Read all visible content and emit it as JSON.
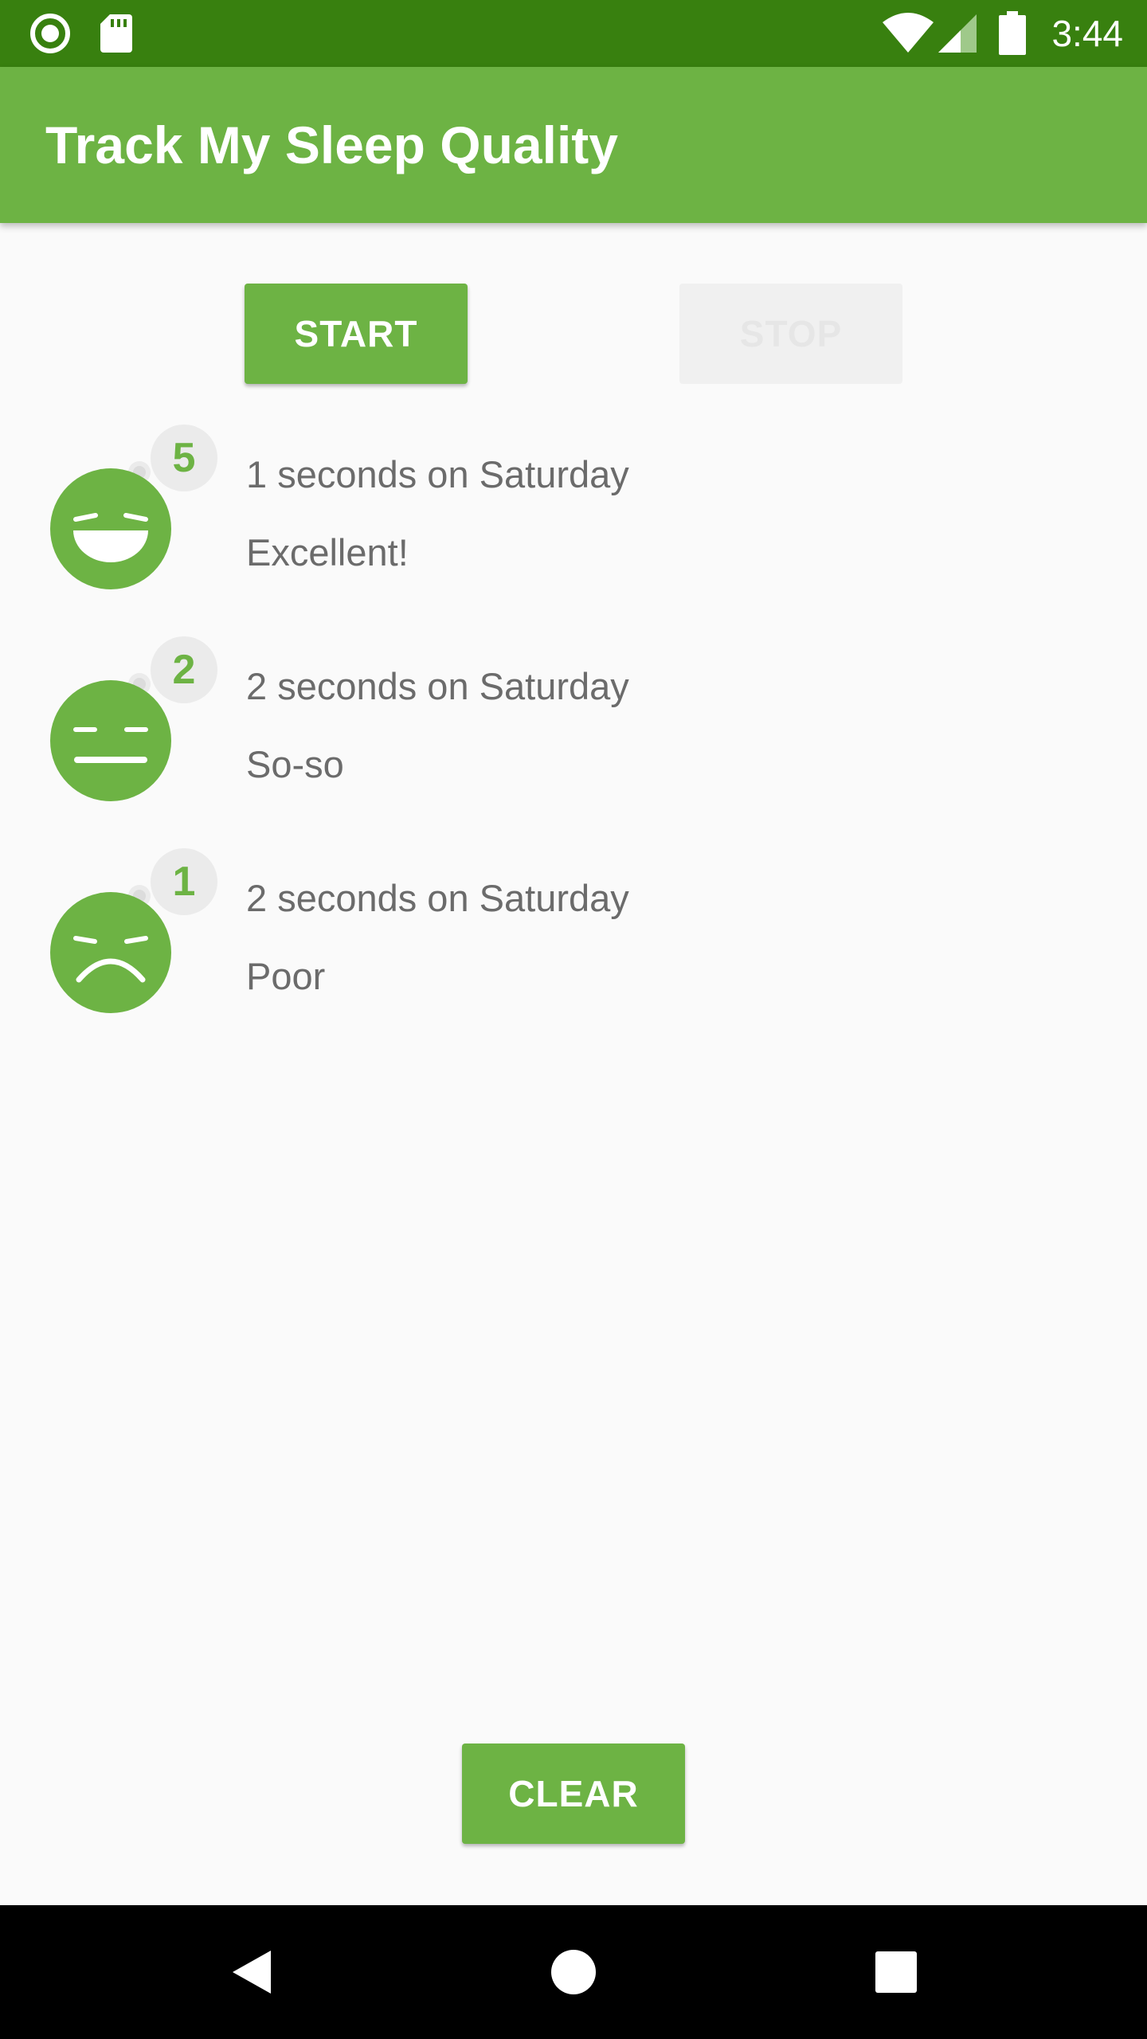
{
  "status_bar": {
    "time": "3:44",
    "icons": [
      "record-icon",
      "sd-card-icon",
      "wifi-icon",
      "cell-signal-icon",
      "battery-icon"
    ]
  },
  "app_bar": {
    "title": "Track My Sleep Quality"
  },
  "controls": {
    "start_label": "START",
    "stop_label": "STOP",
    "clear_label": "CLEAR"
  },
  "nights": [
    {
      "rating": "5",
      "duration": "1 seconds on Saturday",
      "quality": "Excellent!",
      "face": "laughing-face-icon"
    },
    {
      "rating": "2",
      "duration": "2 seconds on Saturday",
      "quality": "So-so",
      "face": "neutral-face-icon"
    },
    {
      "rating": "1",
      "duration": "2 seconds on Saturday",
      "quality": "Poor",
      "face": "frown-face-icon"
    }
  ],
  "nav_bar": {
    "icons": [
      "back-icon",
      "home-icon",
      "recents-icon"
    ]
  },
  "colors": {
    "primary": "#6db344",
    "primary_dark": "#38800f",
    "background": "#fafafa",
    "text_secondary": "#6b6b6b",
    "disabled_button": "#f0f0f0"
  }
}
